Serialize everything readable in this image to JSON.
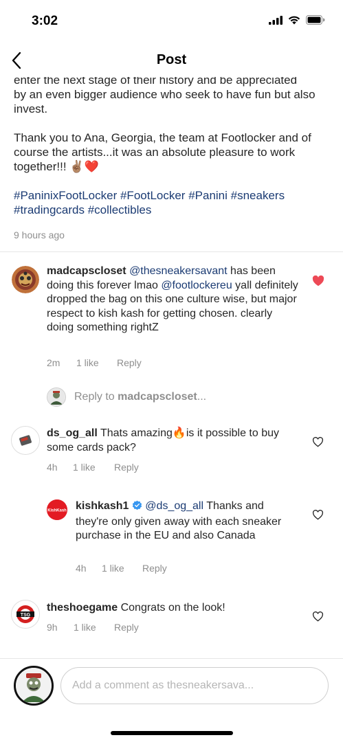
{
  "status": {
    "time": "3:02"
  },
  "nav": {
    "title": "Post"
  },
  "caption": {
    "line_partial": "enter the next stage of their history and be appreciated",
    "line_rest": "by an even bigger audience who seek to have fun but also invest.",
    "thanks": "Thank you to Ana, Georgia, the team at Footlocker and of course the artists...it was an absolute pleasure to work together!!! ✌🏽❤️",
    "hashtags": "#PaninixFootLocker #FootLocker #Panini #sneakers #tradingcards #collectibles",
    "time": "9 hours ago"
  },
  "comments": [
    {
      "username": "madcapscloset",
      "mention1": "@thesneakersavant",
      "text1": " has been doing this forever lmao ",
      "mention2": "@footlockereu",
      "text2": " yall definitely dropped the bag on this one culture wise, but major respect to kish kash for getting chosen. clearly doing something rightZ",
      "time": "2m",
      "likes": "1 like",
      "reply": "Reply",
      "liked": true,
      "like_color": "#ed4956"
    },
    {
      "username": "ds_og_all",
      "text": " Thats amazing🔥is it possible to buy some cards pack?",
      "time": "4h",
      "likes": "1 like",
      "reply": "Reply",
      "liked": false
    },
    {
      "username": "kishkash1",
      "verified": true,
      "mention": "@ds_og_all",
      "text": " Thanks and they're only given away with each sneaker purchase in the EU and also Canada",
      "time": "4h",
      "likes": "1 like",
      "reply": "Reply",
      "liked": false,
      "avatar_label": "KishKash"
    },
    {
      "username": "theshoegame",
      "text": " Congrats on the look!",
      "time": "9h",
      "likes": "1 like",
      "reply": "Reply",
      "liked": false
    }
  ],
  "reply_to": {
    "prefix": "Reply to ",
    "username": "madcapscloset",
    "suffix": "..."
  },
  "composer": {
    "placeholder": "Add a comment as thesneakersava..."
  },
  "colors": {
    "link": "#1b3b73",
    "meta": "#8e8e8e",
    "heart_liked": "#ed4956",
    "verified": "#3897f0"
  }
}
